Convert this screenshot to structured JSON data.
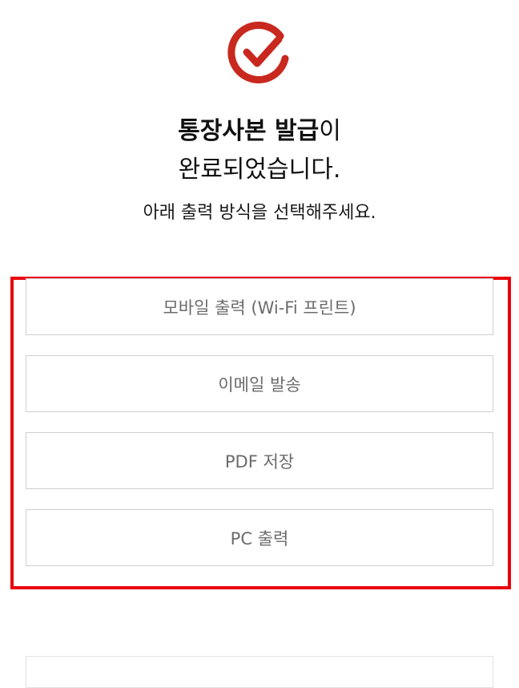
{
  "header": {
    "icon": "check-circle-icon",
    "title_bold": "통장사본 발급",
    "title_suffix": "이",
    "title_line2": "완료되었습니다.",
    "subtitle": "아래 출력 방식을 선택해주세요."
  },
  "options": [
    {
      "label": "모바일 출력 (Wi-Fi 프린트)"
    },
    {
      "label": "이메일 발송"
    },
    {
      "label": "PDF 저장"
    },
    {
      "label": "PC 출력"
    }
  ],
  "colors": {
    "accent": "#c8281e",
    "highlight": "#e8000b",
    "button_border": "#cfcfcf",
    "button_text": "#6b6b6b"
  }
}
